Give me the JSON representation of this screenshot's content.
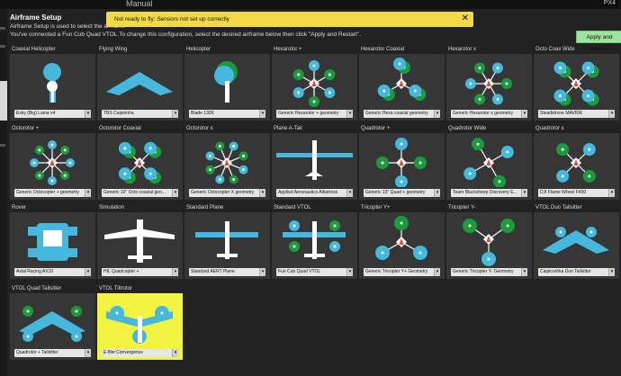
{
  "topbar": {
    "mode": "Manual",
    "brand": "PX4"
  },
  "page": {
    "title": "Airframe Setup",
    "desc1": "Airframe Setup is used to select the airframe",
    "desc2": "You've connected a Fun Cub Quad VTOL.To change this configuration, select the desired airframe below then click \"Apply and Restart\".",
    "apply_label": "Apply and Restart"
  },
  "banner": {
    "message": "Not ready to fly: Sensors not set up correctly",
    "close": "✕"
  },
  "colors": {
    "blue": "#46b8de",
    "green": "#1c9b3e",
    "arrow": "#e8432e",
    "tile": "#363636",
    "selected": "#f2f241",
    "apply": "#9fe3a3",
    "banner": "#f3d848"
  },
  "tiles": [
    {
      "label": "Coaxial Helicopter",
      "value": "Esky (Big) Lama v4",
      "icon": "coax-heli-icon"
    },
    {
      "label": "Flying Wing",
      "value": "TBS Caipirinha",
      "icon": "flying-wing-icon"
    },
    {
      "label": "Helicopter",
      "value": "Blade 130X",
      "icon": "helicopter-icon"
    },
    {
      "label": "Hexarotor +",
      "value": "Generic Hexarotor + geometry",
      "icon": "hexa-plus-icon"
    },
    {
      "label": "Hexarotor Coaxial",
      "value": "Generic Hexa coaxial geometry",
      "icon": "hexa-coax-icon"
    },
    {
      "label": "Hexarotor x",
      "value": "Generic Hexarotor x geometry",
      "icon": "hexa-x-icon"
    },
    {
      "label": "Octo Coax Wide",
      "value": "Steadidrone MAVRIK",
      "icon": "octo-coax-wide-icon"
    },
    {
      "label": "Octorotor +",
      "value": "Generic Octocopter + geometry",
      "icon": "octo-plus-icon"
    },
    {
      "label": "Octorotor Coaxial",
      "value": "Generic 10\" Octo coaxial geo...",
      "icon": "octo-coax-icon"
    },
    {
      "label": "Octorotor x",
      "value": "Generic Octocopter X geometry",
      "icon": "octo-x-icon"
    },
    {
      "label": "Plane A-Tail",
      "value": "Applied Aeronautics Albatross",
      "icon": "plane-atail-icon"
    },
    {
      "label": "Quadrotor +",
      "value": "Generic 10\" Quad + geometry",
      "icon": "quad-plus-icon"
    },
    {
      "label": "Quadrotor Wide",
      "value": "Team Blacksheep Discovery E...",
      "icon": "quad-wide-icon"
    },
    {
      "label": "Quadrotor x",
      "value": "DJI Flame Wheel F450",
      "icon": "quad-x-icon"
    },
    {
      "label": "Rover",
      "value": "Axial Racing AX10",
      "icon": "rover-icon"
    },
    {
      "label": "Simulation",
      "value": "HIL Quadcopter +",
      "icon": "simulation-icon"
    },
    {
      "label": "Standard Plane",
      "value": "Standard AERT Plane",
      "icon": "standard-plane-icon"
    },
    {
      "label": "Standard VTOL",
      "value": "Fun Cub Quad VTOL",
      "icon": "standard-vtol-icon"
    },
    {
      "label": "Tricopter Y+",
      "value": "Generic Tricopter Y+ Geometry",
      "icon": "tricopter-yplus-icon"
    },
    {
      "label": "Tricopter Y-",
      "value": "Generic Tricopter Y- Geometry",
      "icon": "tricopter-yminus-icon"
    },
    {
      "label": "VTOL Duo Tailsitter",
      "value": "Caipiroshka Duo Tailsitter",
      "icon": "vtol-duo-tailsitter-icon"
    },
    {
      "label": "VTOL Quad Tailsitter",
      "value": "Quadrotor + Tailsitter",
      "icon": "vtol-quad-tailsitter-icon"
    },
    {
      "label": "VTOL Tiltrotor",
      "value": "E-flite Convergence",
      "icon": "vtol-tiltrotor-icon",
      "selected": true
    }
  ]
}
